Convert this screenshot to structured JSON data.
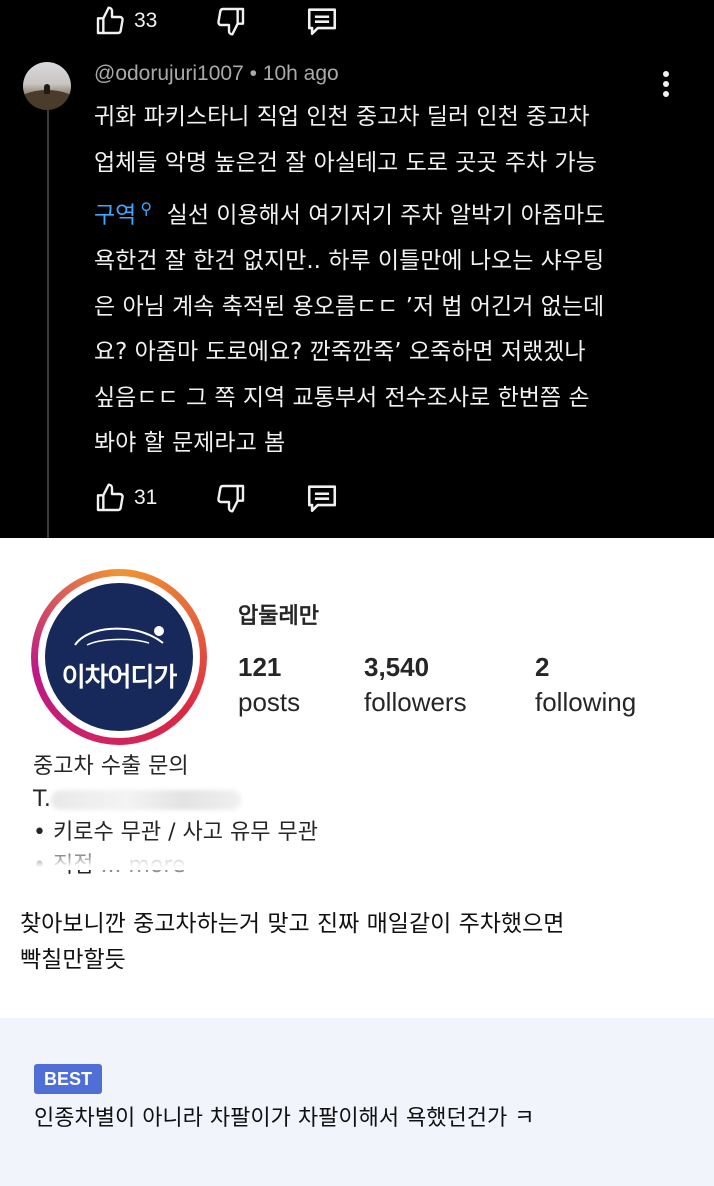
{
  "youtube": {
    "prev_comment": {
      "likes": "33"
    },
    "comment": {
      "username": "@odorujuri1007",
      "time": "10h ago",
      "lines": [
        "귀화 파키스타니 직업 인천 중고차 딜러 인천 중고차",
        "업체들 악명 높은건 잘 아실테고 도로 곳곳 주차 가능",
        "실선 이용해서 여기저기 주차 알박기 아줌마도",
        "욕한건 잘 한건 없지만.. 하루 이틀만에 나오는 샤우팅",
        "은 아님 계속 축적된 용오름ㄷㄷ ’저 법 어긴거 없는데",
        "요? 아줌마 도로에요? 깐죽깐죽’ 오죽하면 저랬겠나",
        "싶음ㄷㄷ 그 쪽 지역 교통부서 전수조사로 한번쯤 손",
        "봐야 할 문제라고 봄"
      ],
      "search_link": "구역",
      "likes": "31"
    },
    "icons": {
      "like": "thumbs-up-icon",
      "dislike": "thumbs-down-icon",
      "reply": "reply-icon",
      "more": "more-vert-icon",
      "link": "search-icon"
    }
  },
  "instagram": {
    "logo_text": "이차어디가",
    "username": "압둘레만",
    "stats": {
      "posts": {
        "value": "121",
        "label": "posts"
      },
      "followers": {
        "value": "3,540",
        "label": "followers"
      },
      "following": {
        "value": "2",
        "label": "following"
      }
    },
    "bio": {
      "line1": "중고차 수출 문의",
      "phone_prefix": "T.",
      "line3": "• 키로수 무관 / 사고 유무 무관",
      "line4": "• 직접",
      "more": "... more"
    }
  },
  "remark": {
    "line1": "찾아보니깐 중고차하는거 맞고 진짜 매일같이 주차했으면",
    "line2": "빡칠만할듯"
  },
  "best": {
    "badge": "BEST",
    "text": "인종차별이 아니라 차팔이가 차팔이해서 욕했던건가 ㅋ"
  },
  "colors": {
    "dark_bg": "#000000",
    "link": "#3ea6ff",
    "best_badge": "#4f6fd6",
    "best_bg": "#f1f4fb",
    "logo_bg": "#16295a"
  }
}
